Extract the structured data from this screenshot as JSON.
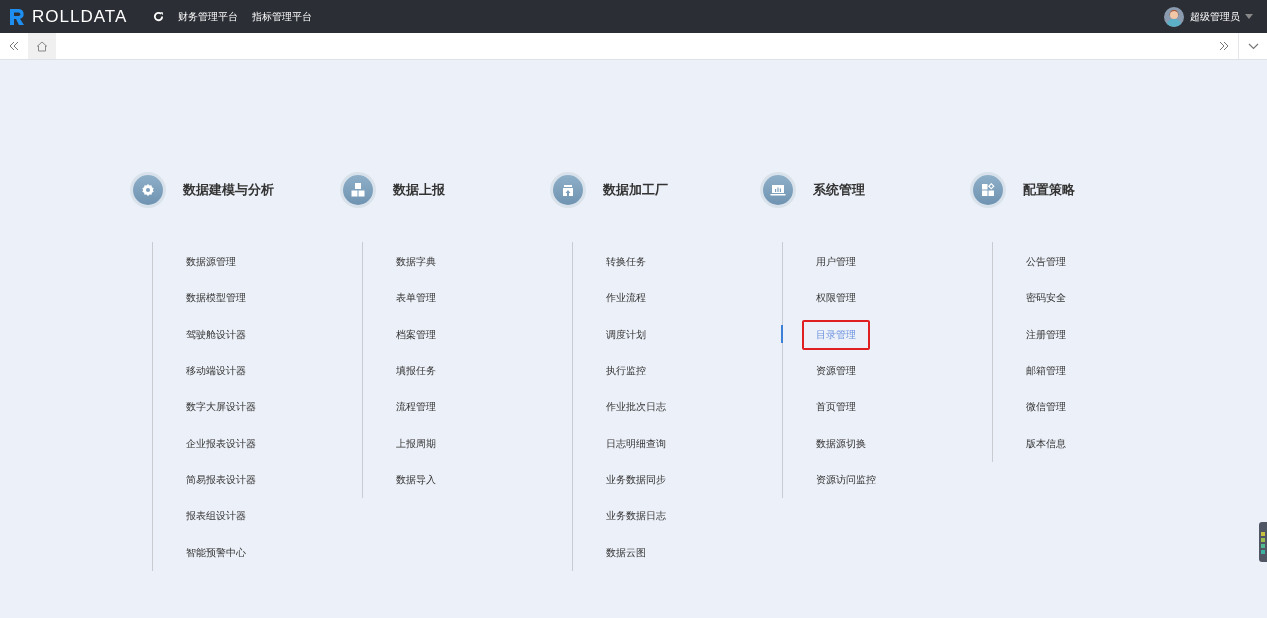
{
  "brand": "ROLLDATA",
  "nav": [
    {
      "label": "财务管理平台"
    },
    {
      "label": "指标管理平台"
    }
  ],
  "user": {
    "name": "超级管理员"
  },
  "groups": [
    {
      "title": "数据建模与分析",
      "items": [
        {
          "label": "数据源管理",
          "selected": false
        },
        {
          "label": "数据模型管理",
          "selected": false
        },
        {
          "label": "驾驶舱设计器",
          "selected": false
        },
        {
          "label": "移动端设计器",
          "selected": false
        },
        {
          "label": "数字大屏设计器",
          "selected": false
        },
        {
          "label": "企业报表设计器",
          "selected": false
        },
        {
          "label": "简易报表设计器",
          "selected": false
        },
        {
          "label": "报表组设计器",
          "selected": false
        },
        {
          "label": "智能预警中心",
          "selected": false
        }
      ]
    },
    {
      "title": "数据上报",
      "items": [
        {
          "label": "数据字典",
          "selected": false
        },
        {
          "label": "表单管理",
          "selected": false
        },
        {
          "label": "档案管理",
          "selected": false
        },
        {
          "label": "填报任务",
          "selected": false
        },
        {
          "label": "流程管理",
          "selected": false
        },
        {
          "label": "上报周期",
          "selected": false
        },
        {
          "label": "数据导入",
          "selected": false
        }
      ]
    },
    {
      "title": "数据加工厂",
      "items": [
        {
          "label": "转换任务",
          "selected": false
        },
        {
          "label": "作业流程",
          "selected": false
        },
        {
          "label": "调度计划",
          "selected": false
        },
        {
          "label": "执行监控",
          "selected": false
        },
        {
          "label": "作业批次日志",
          "selected": false
        },
        {
          "label": "日志明细查询",
          "selected": false
        },
        {
          "label": "业务数据同步",
          "selected": false
        },
        {
          "label": "业务数据日志",
          "selected": false
        },
        {
          "label": "数据云图",
          "selected": false
        }
      ]
    },
    {
      "title": "系统管理",
      "items": [
        {
          "label": "用户管理",
          "selected": false
        },
        {
          "label": "权限管理",
          "selected": false
        },
        {
          "label": "目录管理",
          "selected": true
        },
        {
          "label": "资源管理",
          "selected": false
        },
        {
          "label": "首页管理",
          "selected": false
        },
        {
          "label": "数据源切换",
          "selected": false
        },
        {
          "label": "资源访问监控",
          "selected": false
        }
      ]
    },
    {
      "title": "配置策略",
      "items": [
        {
          "label": "公告管理",
          "selected": false
        },
        {
          "label": "密码安全",
          "selected": false
        },
        {
          "label": "注册管理",
          "selected": false
        },
        {
          "label": "邮箱管理",
          "selected": false
        },
        {
          "label": "微信管理",
          "selected": false
        },
        {
          "label": "版本信息",
          "selected": false
        }
      ]
    }
  ]
}
